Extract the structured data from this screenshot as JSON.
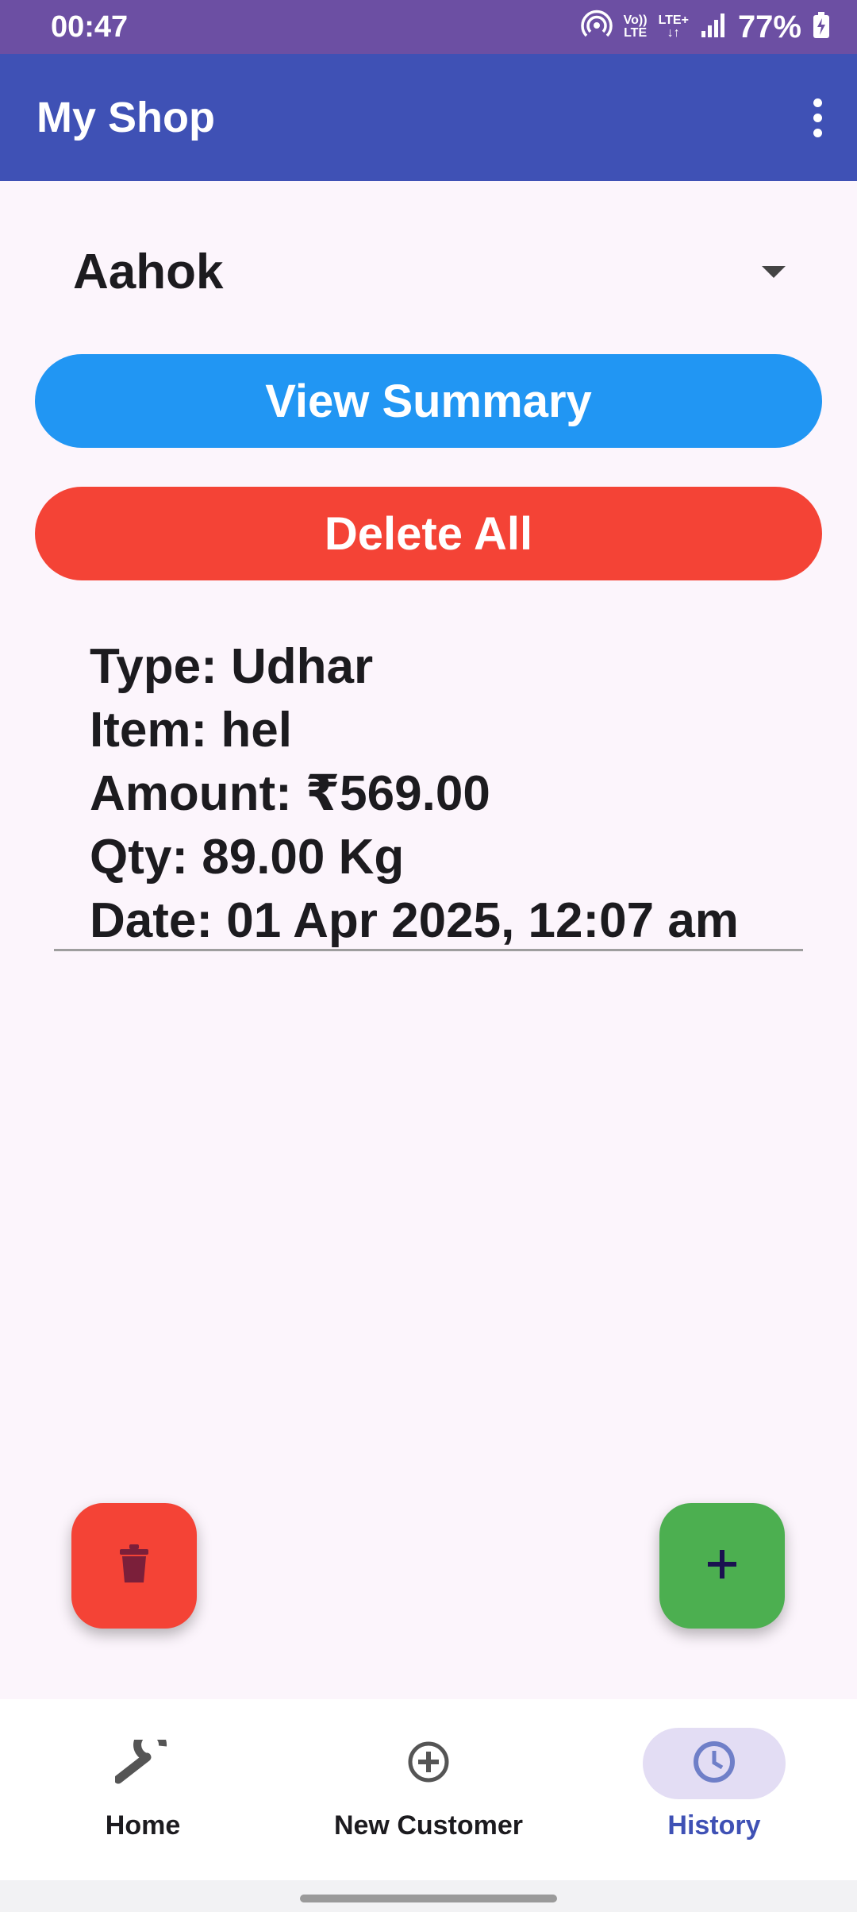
{
  "status_bar": {
    "time": "00:47",
    "volte_top": "Vo))",
    "volte_bottom": "LTE",
    "lte_plus": "LTE+",
    "battery": "77%"
  },
  "app_bar": {
    "title": "My Shop",
    "menu_icon": "more-vert-icon"
  },
  "customer_select": {
    "selected": "Aahok"
  },
  "buttons": {
    "view_summary": "View Summary",
    "delete_all": "Delete All"
  },
  "records": [
    {
      "type": "Type: Udhar",
      "item": "Item: hel",
      "amount": "Amount: ₹569.00",
      "qty": "Qty: 89.00 Kg",
      "date": "Date: 01 Apr 2025, 12:07 am"
    }
  ],
  "fabs": {
    "delete_icon": "trash-icon",
    "add_icon": "plus-icon"
  },
  "bottom_nav": {
    "items": [
      {
        "label": "Home",
        "icon": "wrench-icon",
        "active": false
      },
      {
        "label": "New Customer",
        "icon": "add-circle-icon",
        "active": false
      },
      {
        "label": "History",
        "icon": "clock-icon",
        "active": true
      }
    ]
  },
  "colors": {
    "status_bar": "#6C4FA3",
    "app_bar": "#3F51B5",
    "summary_button": "#2196F3",
    "delete_button": "#F44336",
    "add_fab": "#4CAF50",
    "active_nav": "#3F51B5"
  }
}
